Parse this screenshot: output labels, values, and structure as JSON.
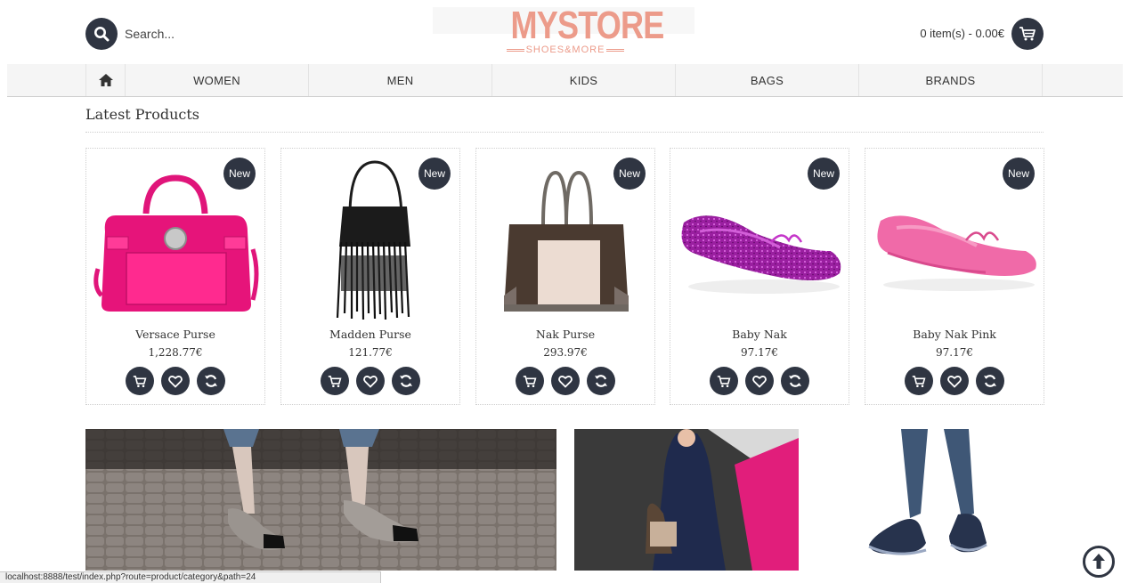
{
  "header": {
    "search_placeholder": "Search...",
    "logo_main": "MYSTORE",
    "logo_sub": "SHOES&MORE",
    "cart_summary": "0 item(s) - 0.00€"
  },
  "nav": {
    "items": [
      "WOMEN",
      "MEN",
      "KIDS",
      "BAGS",
      "BRANDS"
    ]
  },
  "section": {
    "title": "Latest Products"
  },
  "products": [
    {
      "name": "Versace Purse",
      "price": "1,228.77€",
      "badge": "New"
    },
    {
      "name": "Madden Purse",
      "price": "121.77€",
      "badge": "New"
    },
    {
      "name": "Nak Purse",
      "price": "293.97€",
      "badge": "New"
    },
    {
      "name": "Baby Nak",
      "price": "97.17€",
      "badge": "New"
    },
    {
      "name": "Baby Nak Pink",
      "price": "97.17€",
      "badge": "New"
    }
  ],
  "status_bar": {
    "url": "localhost:8888/test/index.php?route=product/category&path=24"
  },
  "colors": {
    "dark": "#2f3542",
    "logo": "#ec9b8a",
    "magenta": "#e0157a"
  }
}
